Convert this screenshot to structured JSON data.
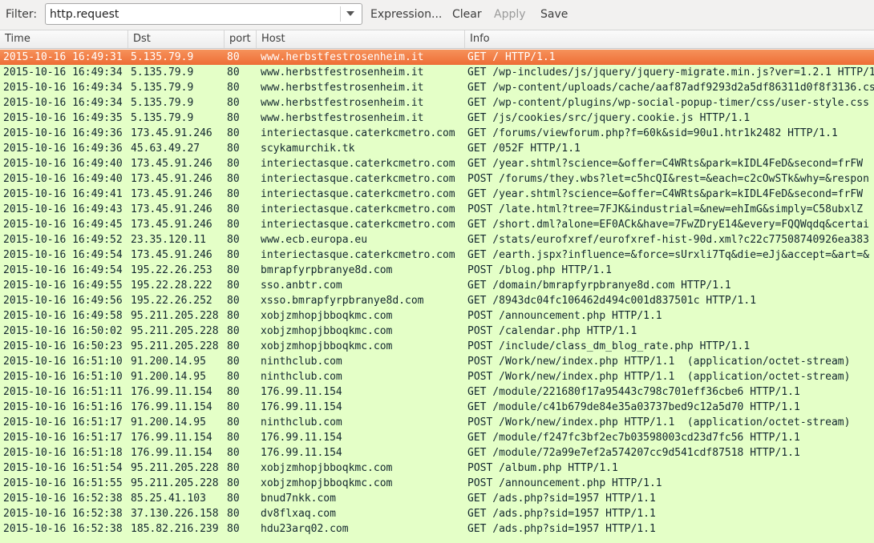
{
  "filter": {
    "label": "Filter:",
    "value": "http.request",
    "buttons": {
      "expression": "Expression...",
      "clear": "Clear",
      "apply": "Apply",
      "save": "Save"
    }
  },
  "columns": {
    "time": "Time",
    "dst": "Dst",
    "port": "port",
    "host": "Host",
    "info": "Info"
  },
  "colors": {
    "row_bg": "#e4ffc7",
    "selected_bg": "#ee6d36"
  },
  "rows": [
    {
      "time": "2015-10-16 16:49:31",
      "dst": "5.135.79.9",
      "port": "80",
      "host": "www.herbstfestrosenheim.it",
      "info": "GET / HTTP/1.1",
      "selected": true
    },
    {
      "time": "2015-10-16 16:49:34",
      "dst": "5.135.79.9",
      "port": "80",
      "host": "www.herbstfestrosenheim.it",
      "info": "GET /wp-includes/js/jquery/jquery-migrate.min.js?ver=1.2.1 HTTP/1.1"
    },
    {
      "time": "2015-10-16 16:49:34",
      "dst": "5.135.79.9",
      "port": "80",
      "host": "www.herbstfestrosenheim.it",
      "info": "GET /wp-content/uploads/cache/aaf87adf9293d2a5df86311d0f8f3136.css"
    },
    {
      "time": "2015-10-16 16:49:34",
      "dst": "5.135.79.9",
      "port": "80",
      "host": "www.herbstfestrosenheim.it",
      "info": "GET /wp-content/plugins/wp-social-popup-timer/css/user-style.css"
    },
    {
      "time": "2015-10-16 16:49:35",
      "dst": "5.135.79.9",
      "port": "80",
      "host": "www.herbstfestrosenheim.it",
      "info": "GET /js/cookies/src/jquery.cookie.js HTTP/1.1"
    },
    {
      "time": "2015-10-16 16:49:36",
      "dst": "173.45.91.246",
      "port": "80",
      "host": "interiectasque.caterkcmetro.com",
      "info": "GET /forums/viewforum.php?f=60k&sid=90u1.htr1k2482 HTTP/1.1"
    },
    {
      "time": "2015-10-16 16:49:36",
      "dst": "45.63.49.27",
      "port": "80",
      "host": "scykamurchik.tk",
      "info": "GET /052F HTTP/1.1"
    },
    {
      "time": "2015-10-16 16:49:40",
      "dst": "173.45.91.246",
      "port": "80",
      "host": "interiectasque.caterkcmetro.com",
      "info": "GET /year.shtml?science=&offer=C4WRts&park=kIDL4FeD&second=frFW"
    },
    {
      "time": "2015-10-16 16:49:40",
      "dst": "173.45.91.246",
      "port": "80",
      "host": "interiectasque.caterkcmetro.com",
      "info": "POST /forums/they.wbs?let=c5hcQI&rest=&each=c2cOwSTk&why=&respon"
    },
    {
      "time": "2015-10-16 16:49:41",
      "dst": "173.45.91.246",
      "port": "80",
      "host": "interiectasque.caterkcmetro.com",
      "info": "GET /year.shtml?science=&offer=C4WRts&park=kIDL4FeD&second=frFW"
    },
    {
      "time": "2015-10-16 16:49:43",
      "dst": "173.45.91.246",
      "port": "80",
      "host": "interiectasque.caterkcmetro.com",
      "info": "POST /late.html?tree=7FJK&industrial=&new=ehImG&simply=C58ubxlZ"
    },
    {
      "time": "2015-10-16 16:49:45",
      "dst": "173.45.91.246",
      "port": "80",
      "host": "interiectasque.caterkcmetro.com",
      "info": "GET /short.dml?alone=EF0ACk&have=7FwZDryE14&every=FQQWqdq&certai"
    },
    {
      "time": "2015-10-16 16:49:52",
      "dst": "23.35.120.11",
      "port": "80",
      "host": "www.ecb.europa.eu",
      "info": "GET /stats/eurofxref/eurofxref-hist-90d.xml?c22c77508740926ea383"
    },
    {
      "time": "2015-10-16 16:49:54",
      "dst": "173.45.91.246",
      "port": "80",
      "host": "interiectasque.caterkcmetro.com",
      "info": "GET /earth.jspx?influence=&force=sUrxli7Tq&die=eJj&accept=&art=&"
    },
    {
      "time": "2015-10-16 16:49:54",
      "dst": "195.22.26.253",
      "port": "80",
      "host": "bmrapfyrpbranye8d.com",
      "info": "POST /blog.php HTTP/1.1"
    },
    {
      "time": "2015-10-16 16:49:55",
      "dst": "195.22.28.222",
      "port": "80",
      "host": "sso.anbtr.com",
      "info": "GET /domain/bmrapfyrpbranye8d.com HTTP/1.1"
    },
    {
      "time": "2015-10-16 16:49:56",
      "dst": "195.22.26.252",
      "port": "80",
      "host": "xsso.bmrapfyrpbranye8d.com",
      "info": "GET /8943dc04fc106462d494c001d837501c HTTP/1.1"
    },
    {
      "time": "2015-10-16 16:49:58",
      "dst": "95.211.205.228",
      "port": "80",
      "host": "xobjzmhopjbboqkmc.com",
      "info": "POST /announcement.php HTTP/1.1"
    },
    {
      "time": "2015-10-16 16:50:02",
      "dst": "95.211.205.228",
      "port": "80",
      "host": "xobjzmhopjbboqkmc.com",
      "info": "POST /calendar.php HTTP/1.1"
    },
    {
      "time": "2015-10-16 16:50:23",
      "dst": "95.211.205.228",
      "port": "80",
      "host": "xobjzmhopjbboqkmc.com",
      "info": "POST /include/class_dm_blog_rate.php HTTP/1.1"
    },
    {
      "time": "2015-10-16 16:51:10",
      "dst": "91.200.14.95",
      "port": "80",
      "host": "ninthclub.com",
      "info": "POST /Work/new/index.php HTTP/1.1  (application/octet-stream)"
    },
    {
      "time": "2015-10-16 16:51:10",
      "dst": "91.200.14.95",
      "port": "80",
      "host": "ninthclub.com",
      "info": "POST /Work/new/index.php HTTP/1.1  (application/octet-stream)"
    },
    {
      "time": "2015-10-16 16:51:11",
      "dst": "176.99.11.154",
      "port": "80",
      "host": "176.99.11.154",
      "info": "GET /module/221680f17a95443c798c701eff36cbe6 HTTP/1.1"
    },
    {
      "time": "2015-10-16 16:51:16",
      "dst": "176.99.11.154",
      "port": "80",
      "host": "176.99.11.154",
      "info": "GET /module/c41b679de84e35a03737bed9c12a5d70 HTTP/1.1"
    },
    {
      "time": "2015-10-16 16:51:17",
      "dst": "91.200.14.95",
      "port": "80",
      "host": "ninthclub.com",
      "info": "POST /Work/new/index.php HTTP/1.1  (application/octet-stream)"
    },
    {
      "time": "2015-10-16 16:51:17",
      "dst": "176.99.11.154",
      "port": "80",
      "host": "176.99.11.154",
      "info": "GET /module/f247fc3bf2ec7b03598003cd23d7fc56 HTTP/1.1"
    },
    {
      "time": "2015-10-16 16:51:18",
      "dst": "176.99.11.154",
      "port": "80",
      "host": "176.99.11.154",
      "info": "GET /module/72a99e7ef2a574207cc9d541cdf87518 HTTP/1.1"
    },
    {
      "time": "2015-10-16 16:51:54",
      "dst": "95.211.205.228",
      "port": "80",
      "host": "xobjzmhopjbboqkmc.com",
      "info": "POST /album.php HTTP/1.1"
    },
    {
      "time": "2015-10-16 16:51:55",
      "dst": "95.211.205.228",
      "port": "80",
      "host": "xobjzmhopjbboqkmc.com",
      "info": "POST /announcement.php HTTP/1.1"
    },
    {
      "time": "2015-10-16 16:52:38",
      "dst": "85.25.41.103",
      "port": "80",
      "host": "bnud7nkk.com",
      "info": "GET /ads.php?sid=1957 HTTP/1.1"
    },
    {
      "time": "2015-10-16 16:52:38",
      "dst": "37.130.226.158",
      "port": "80",
      "host": "dv8flxaq.com",
      "info": "GET /ads.php?sid=1957 HTTP/1.1"
    },
    {
      "time": "2015-10-16 16:52:38",
      "dst": "185.82.216.239",
      "port": "80",
      "host": "hdu23arq02.com",
      "info": "GET /ads.php?sid=1957 HTTP/1.1"
    }
  ]
}
